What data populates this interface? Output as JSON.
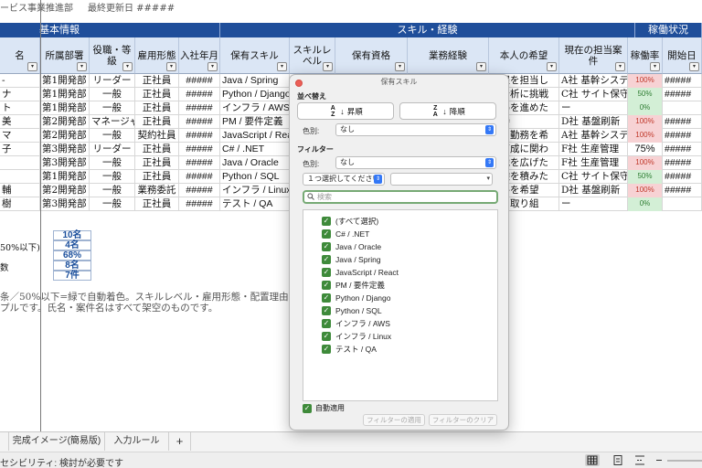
{
  "sheet": {
    "top_line_1": "ービス事業推進部",
    "top_line_2": "最終更新日 #####",
    "bands": {
      "basic": "基本情報",
      "skills": "スキル・経験",
      "status": "稼働状況"
    },
    "headers": {
      "name": "名",
      "dept": "所属部署",
      "role": "役職・等級",
      "employment": "雇用形態",
      "joined": "入社年月",
      "skill": "保有スキル",
      "level": "スキルレベル",
      "cert": "保有資格",
      "experience": "業務経験",
      "wish": "本人の希望",
      "project": "現在の担当案件",
      "rate": "稼働率",
      "start": "開始日"
    },
    "rows": [
      {
        "name": "-",
        "dept": "第1開発部",
        "role": "リーダー",
        "employment": "正社員",
        "joined": "#####",
        "skill": "Java / Spring",
        "wish": "工程を担当し",
        "project": "A社 基幹システム",
        "rate": "100%",
        "start": "#####"
      },
      {
        "name": "ナ",
        "dept": "第1開発部",
        "role": "一般",
        "employment": "正社員",
        "joined": "#####",
        "skill": "Python / Django",
        "wish": "タ分析に挑戦",
        "project": "C社 サイト保守",
        "rate": "50%",
        "start": "#####"
      },
      {
        "name": "ト",
        "dept": "第1開発部",
        "role": "一般",
        "employment": "正社員",
        "joined": "#####",
        "skill": "インフラ / AWS",
        "wish": "取得を進めた",
        "project": "ー",
        "rate": "0%",
        "start": ""
      },
      {
        "name": "美",
        "dept": "第2開発部",
        "role": "マネージャー",
        "employment": "正社員",
        "joined": "#####",
        "skill": "PM / 要件定義",
        "wish": "維持",
        "project": "D社 基盤刷新",
        "rate": "100%",
        "start": "#####"
      },
      {
        "name": "マ",
        "dept": "第2開発部",
        "role": "一般",
        "employment": "契約社員",
        "joined": "#####",
        "skill": "JavaScript / React",
        "wish": "ート勤務を希",
        "project": "A社 基幹システム",
        "rate": "100%",
        "start": "#####"
      },
      {
        "name": "子",
        "dept": "第3開発部",
        "role": "リーダー",
        "employment": "正社員",
        "joined": "#####",
        "skill": "C# / .NET",
        "wish": "の育成に関わ",
        "project": "F社 生産管理",
        "rate": "75%",
        "start": "#####"
      },
      {
        "name": "",
        "dept": "第3開発部",
        "role": "一般",
        "employment": "正社員",
        "joined": "#####",
        "skill": "Java / Oracle",
        "wish": "知識を広げた",
        "project": "F社 生産管理",
        "rate": "100%",
        "start": "#####"
      },
      {
        "name": "",
        "dept": "第1開発部",
        "role": "一般",
        "employment": "正社員",
        "joined": "#####",
        "skill": "Python / SQL",
        "wish": "経験を積みた",
        "project": "C社 サイト保守",
        "rate": "50%",
        "start": "#####"
      },
      {
        "name": "輔",
        "dept": "第2開発部",
        "role": "一般",
        "employment": "業務委託",
        "joined": "#####",
        "skill": "インフラ / Linux",
        "wish": "案件を希望",
        "project": "D社 基盤刷新",
        "rate": "100%",
        "start": "#####"
      },
      {
        "name": "樹",
        "dept": "第3開発部",
        "role": "一般",
        "employment": "正社員",
        "joined": "#####",
        "skill": "テスト / QA",
        "wish": "化に取り組",
        "project": "ー",
        "rate": "0%",
        "start": ""
      }
    ],
    "summary": [
      {
        "label": "",
        "value": "10名"
      },
      {
        "label": "50%以下)",
        "value": "4名"
      },
      {
        "label": "",
        "value": "68%"
      },
      {
        "label": "数",
        "value": "8名"
      },
      {
        "label": "",
        "value": "7件"
      }
    ],
    "note_1": "条／50%以下=緑で自動着色。スキルレベル・雇用形態・配置理由はプル",
    "note_2": "プルです。氏名・案件名はすべて架空のものです。"
  },
  "tabs": [
    {
      "label": "完成イメージ(簡易版)"
    },
    {
      "label": "入力ルール"
    },
    {
      "label": "+"
    }
  ],
  "status": {
    "text": "セシビリティ: 検討が必要です"
  },
  "dialog": {
    "title": "保有スキル",
    "sort_section": "並べ替え",
    "asc_label": "昇順",
    "desc_label": "降順",
    "color_label": "色別:",
    "sort_color_value": "なし",
    "filter_section": "フィルター",
    "filter_color_value": "なし",
    "condition_select": "１つ選択してください",
    "search_placeholder": "検索",
    "items": [
      {
        "label": "(すべて選択)",
        "checked": true
      },
      {
        "label": "C# / .NET",
        "checked": true
      },
      {
        "label": "Java / Oracle",
        "checked": true
      },
      {
        "label": "Java / Spring",
        "checked": true
      },
      {
        "label": "JavaScript / React",
        "checked": true
      },
      {
        "label": "PM / 要件定義",
        "checked": true
      },
      {
        "label": "Python / Django",
        "checked": true
      },
      {
        "label": "Python / SQL",
        "checked": true
      },
      {
        "label": "インフラ / AWS",
        "checked": true
      },
      {
        "label": "インフラ / Linux",
        "checked": true
      },
      {
        "label": "テスト / QA",
        "checked": true
      }
    ],
    "auto_apply_label": "自動適用",
    "apply_button": "フィルターの適用",
    "clear_button": "フィルターのクリア"
  },
  "colors": {
    "band_blue": "#1f4e9a",
    "header_fill": "#dbe6f5",
    "rate_high_fill": "#f7d2d4",
    "rate_high_text": "#c0392b",
    "rate_low_fill": "#d3efd6",
    "rate_low_text": "#2e7d32",
    "checkbox_green": "#3e8a3a",
    "summary_text": "#1b4f9c"
  }
}
